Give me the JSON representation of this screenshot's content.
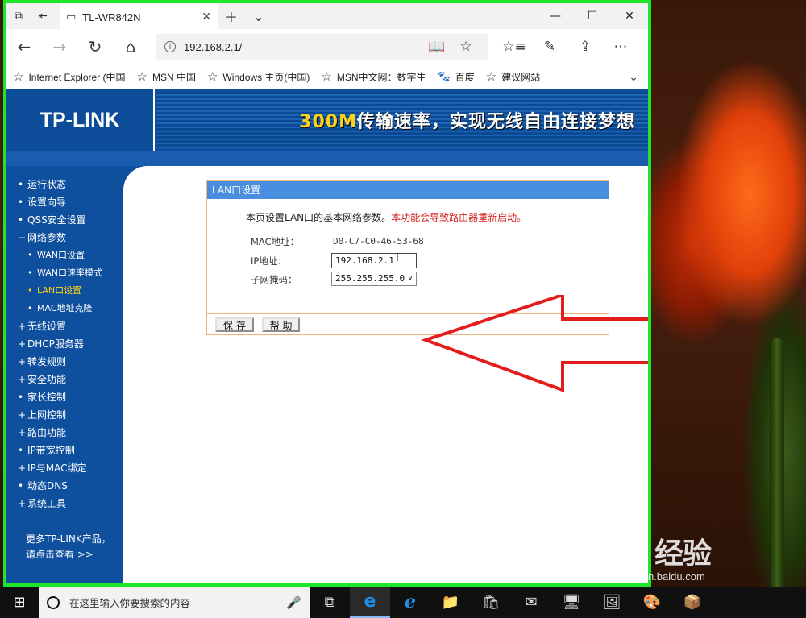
{
  "browser": {
    "tab_title": "TL-WR842N",
    "url": "192.168.2.1/",
    "favorites": [
      {
        "label": "Internet Explorer (中国"
      },
      {
        "label": "MSN 中国"
      },
      {
        "label": "Windows 主页(中国)"
      },
      {
        "label": "MSN中文网：数字生"
      },
      {
        "label": "百度"
      },
      {
        "label": "建议网站"
      }
    ]
  },
  "banner": {
    "logo": "TP-LINK",
    "slogan_accent": "300M",
    "slogan_rest": "传输速率，实现无线自由连接梦想"
  },
  "sidebar": {
    "items": [
      {
        "bullet": "•",
        "label": "运行状态"
      },
      {
        "bullet": "•",
        "label": "设置向导"
      },
      {
        "bullet": "•",
        "label": "QSS安全设置"
      },
      {
        "bullet": "−",
        "label": "网络参数"
      },
      {
        "bullet": "•",
        "label": "WAN口设置"
      },
      {
        "bullet": "•",
        "label": "WAN口速率模式"
      },
      {
        "bullet": "•",
        "label": "LAN口设置"
      },
      {
        "bullet": "•",
        "label": "MAC地址克隆"
      },
      {
        "bullet": "+",
        "label": "无线设置"
      },
      {
        "bullet": "+",
        "label": "DHCP服务器"
      },
      {
        "bullet": "+",
        "label": "转发规则"
      },
      {
        "bullet": "+",
        "label": "安全功能"
      },
      {
        "bullet": "•",
        "label": "家长控制"
      },
      {
        "bullet": "+",
        "label": "上网控制"
      },
      {
        "bullet": "+",
        "label": "路由功能"
      },
      {
        "bullet": "•",
        "label": "IP带宽控制"
      },
      {
        "bullet": "+",
        "label": "IP与MAC绑定"
      },
      {
        "bullet": "•",
        "label": "动态DNS"
      },
      {
        "bullet": "+",
        "label": "系统工具"
      }
    ],
    "more_line1": "更多TP-LINK产品，",
    "more_line2": "请点击查看 >>"
  },
  "lan_panel": {
    "title": "LAN口设置",
    "desc": "本页设置LAN口的基本网络参数。",
    "warning": "本功能会导致路由器重新启动。",
    "mac_label": "MAC地址：",
    "mac_value": "D0-C7-C0-46-53-68",
    "ip_label": "IP地址：",
    "ip_value": "192.168.2.1",
    "mask_label": "子网掩码：",
    "mask_value": "255.255.255.0",
    "save_label": "保 存",
    "help_label": "帮 助"
  },
  "taskbar": {
    "search_placeholder": "在这里输入你要搜索的内容"
  },
  "watermark": {
    "logo": "Bai 经验",
    "url": "jingyan.baidu.com"
  },
  "colors": {
    "window_border": "#1ee62a",
    "tplink_blue": "#0e4f9e",
    "panel_header": "#4a8ee0",
    "warning_red": "#d62020",
    "arrow_red": "#e51c1c"
  }
}
